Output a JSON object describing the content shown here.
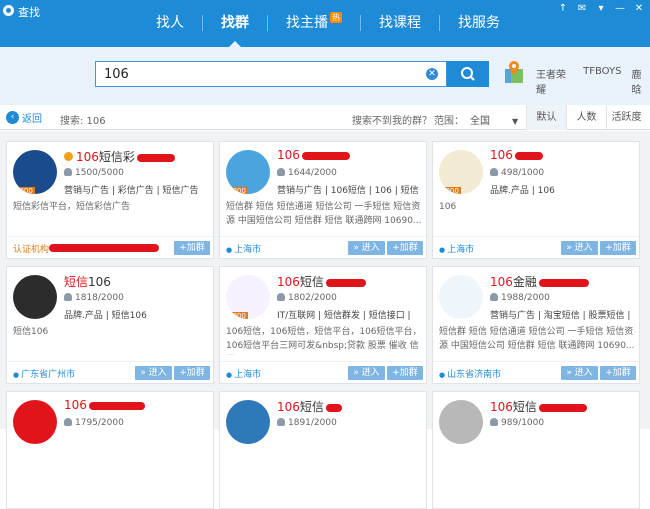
{
  "window": {
    "title": "查找",
    "controls": [
      "↑",
      "✉",
      "▾",
      "—",
      "✕"
    ]
  },
  "nav": {
    "tabs": [
      {
        "label": "找人"
      },
      {
        "label": "找群"
      },
      {
        "label": "找主播",
        "badge": "热"
      },
      {
        "label": "找课程"
      },
      {
        "label": "找服务"
      }
    ]
  },
  "search": {
    "value": "106",
    "hot_links": [
      "王者荣耀",
      "TFBOYS",
      "鹿晗"
    ]
  },
  "toolbar": {
    "back_label": "返回",
    "search_info": "搜索: 106",
    "not_found_text": "搜索不到我的群？",
    "range_label": "范围：",
    "range_value": "全国",
    "sort_options": [
      "默认",
      "人数",
      "活跃度"
    ]
  },
  "buttons": {
    "enter": "» 进入",
    "join": "+加群"
  },
  "cards": [
    {
      "name_prefix": "106",
      "name_rest": "短信彩",
      "members": "1500/5000",
      "tags": "营销与广告 | 彩信广告 | 短信广告",
      "desc": "短信彩信平台，短信彩信广告",
      "footer": "认证机构",
      "level": "5000",
      "avatar_color": "#1a4b8c"
    },
    {
      "name_prefix": "106",
      "name_rest": "",
      "members": "1644/2000",
      "tags": "营销与广告 | 106短信 | 106 | 短信",
      "desc": "短信群 短信 短信通道 短信公司 一手短信 短信资源 中国短信公司 短信群 短信 联通跨网 10690...",
      "footer": "上海市",
      "level": "2000",
      "avatar_color": "#4aa5de"
    },
    {
      "name_prefix": "106",
      "name_rest": "",
      "members": "498/1000",
      "tags": "品牌.产品 | 106",
      "desc": "106",
      "footer": "上海市",
      "level": "2000",
      "avatar_color": "#f3ead4"
    },
    {
      "name_prefix": "短信",
      "name_rest": "106",
      "members": "1818/2000",
      "tags": "品牌.产品 | 短信106",
      "desc": "短信106",
      "footer": "广东省广州市",
      "level": "",
      "avatar_color": "#2c2c2c"
    },
    {
      "name_prefix": "106",
      "name_rest": "短信",
      "members": "1802/2000",
      "tags": "IT/互联网 | 短信群发 | 短信接口 |",
      "desc": "106短信，106短信，短信平台，106短信平台，106短信平台三网可发&nbsp;贷款 股票 催收 信用...",
      "footer": "上海市",
      "level": "2000",
      "avatar_color": "#f7f0ff"
    },
    {
      "name_prefix": "106",
      "name_rest": "金融",
      "members": "1988/2000",
      "tags": "营销与广告 | 淘宝短信 | 股票短信 |",
      "desc": "短信群 短信 短信通道 短信公司 一手短信 短信资源 中国短信公司 短信群 短信 联通跨网 10690...",
      "footer": "山东省济南市",
      "level": "",
      "avatar_color": "#eef5fb"
    },
    {
      "name_prefix": "106",
      "name_rest": "",
      "members": "1795/2000",
      "tags": "",
      "desc": "",
      "footer": "",
      "level": "",
      "avatar_color": "#e2141b"
    },
    {
      "name_prefix": "106",
      "name_rest": "短信",
      "members": "1891/2000",
      "tags": "",
      "desc": "",
      "footer": "",
      "level": "",
      "avatar_color": "#2f79b8"
    },
    {
      "name_prefix": "106",
      "name_rest": "短信",
      "members": "989/1000",
      "tags": "",
      "desc": "",
      "footer": "",
      "level": "",
      "avatar_color": "#b8b8b8"
    }
  ]
}
